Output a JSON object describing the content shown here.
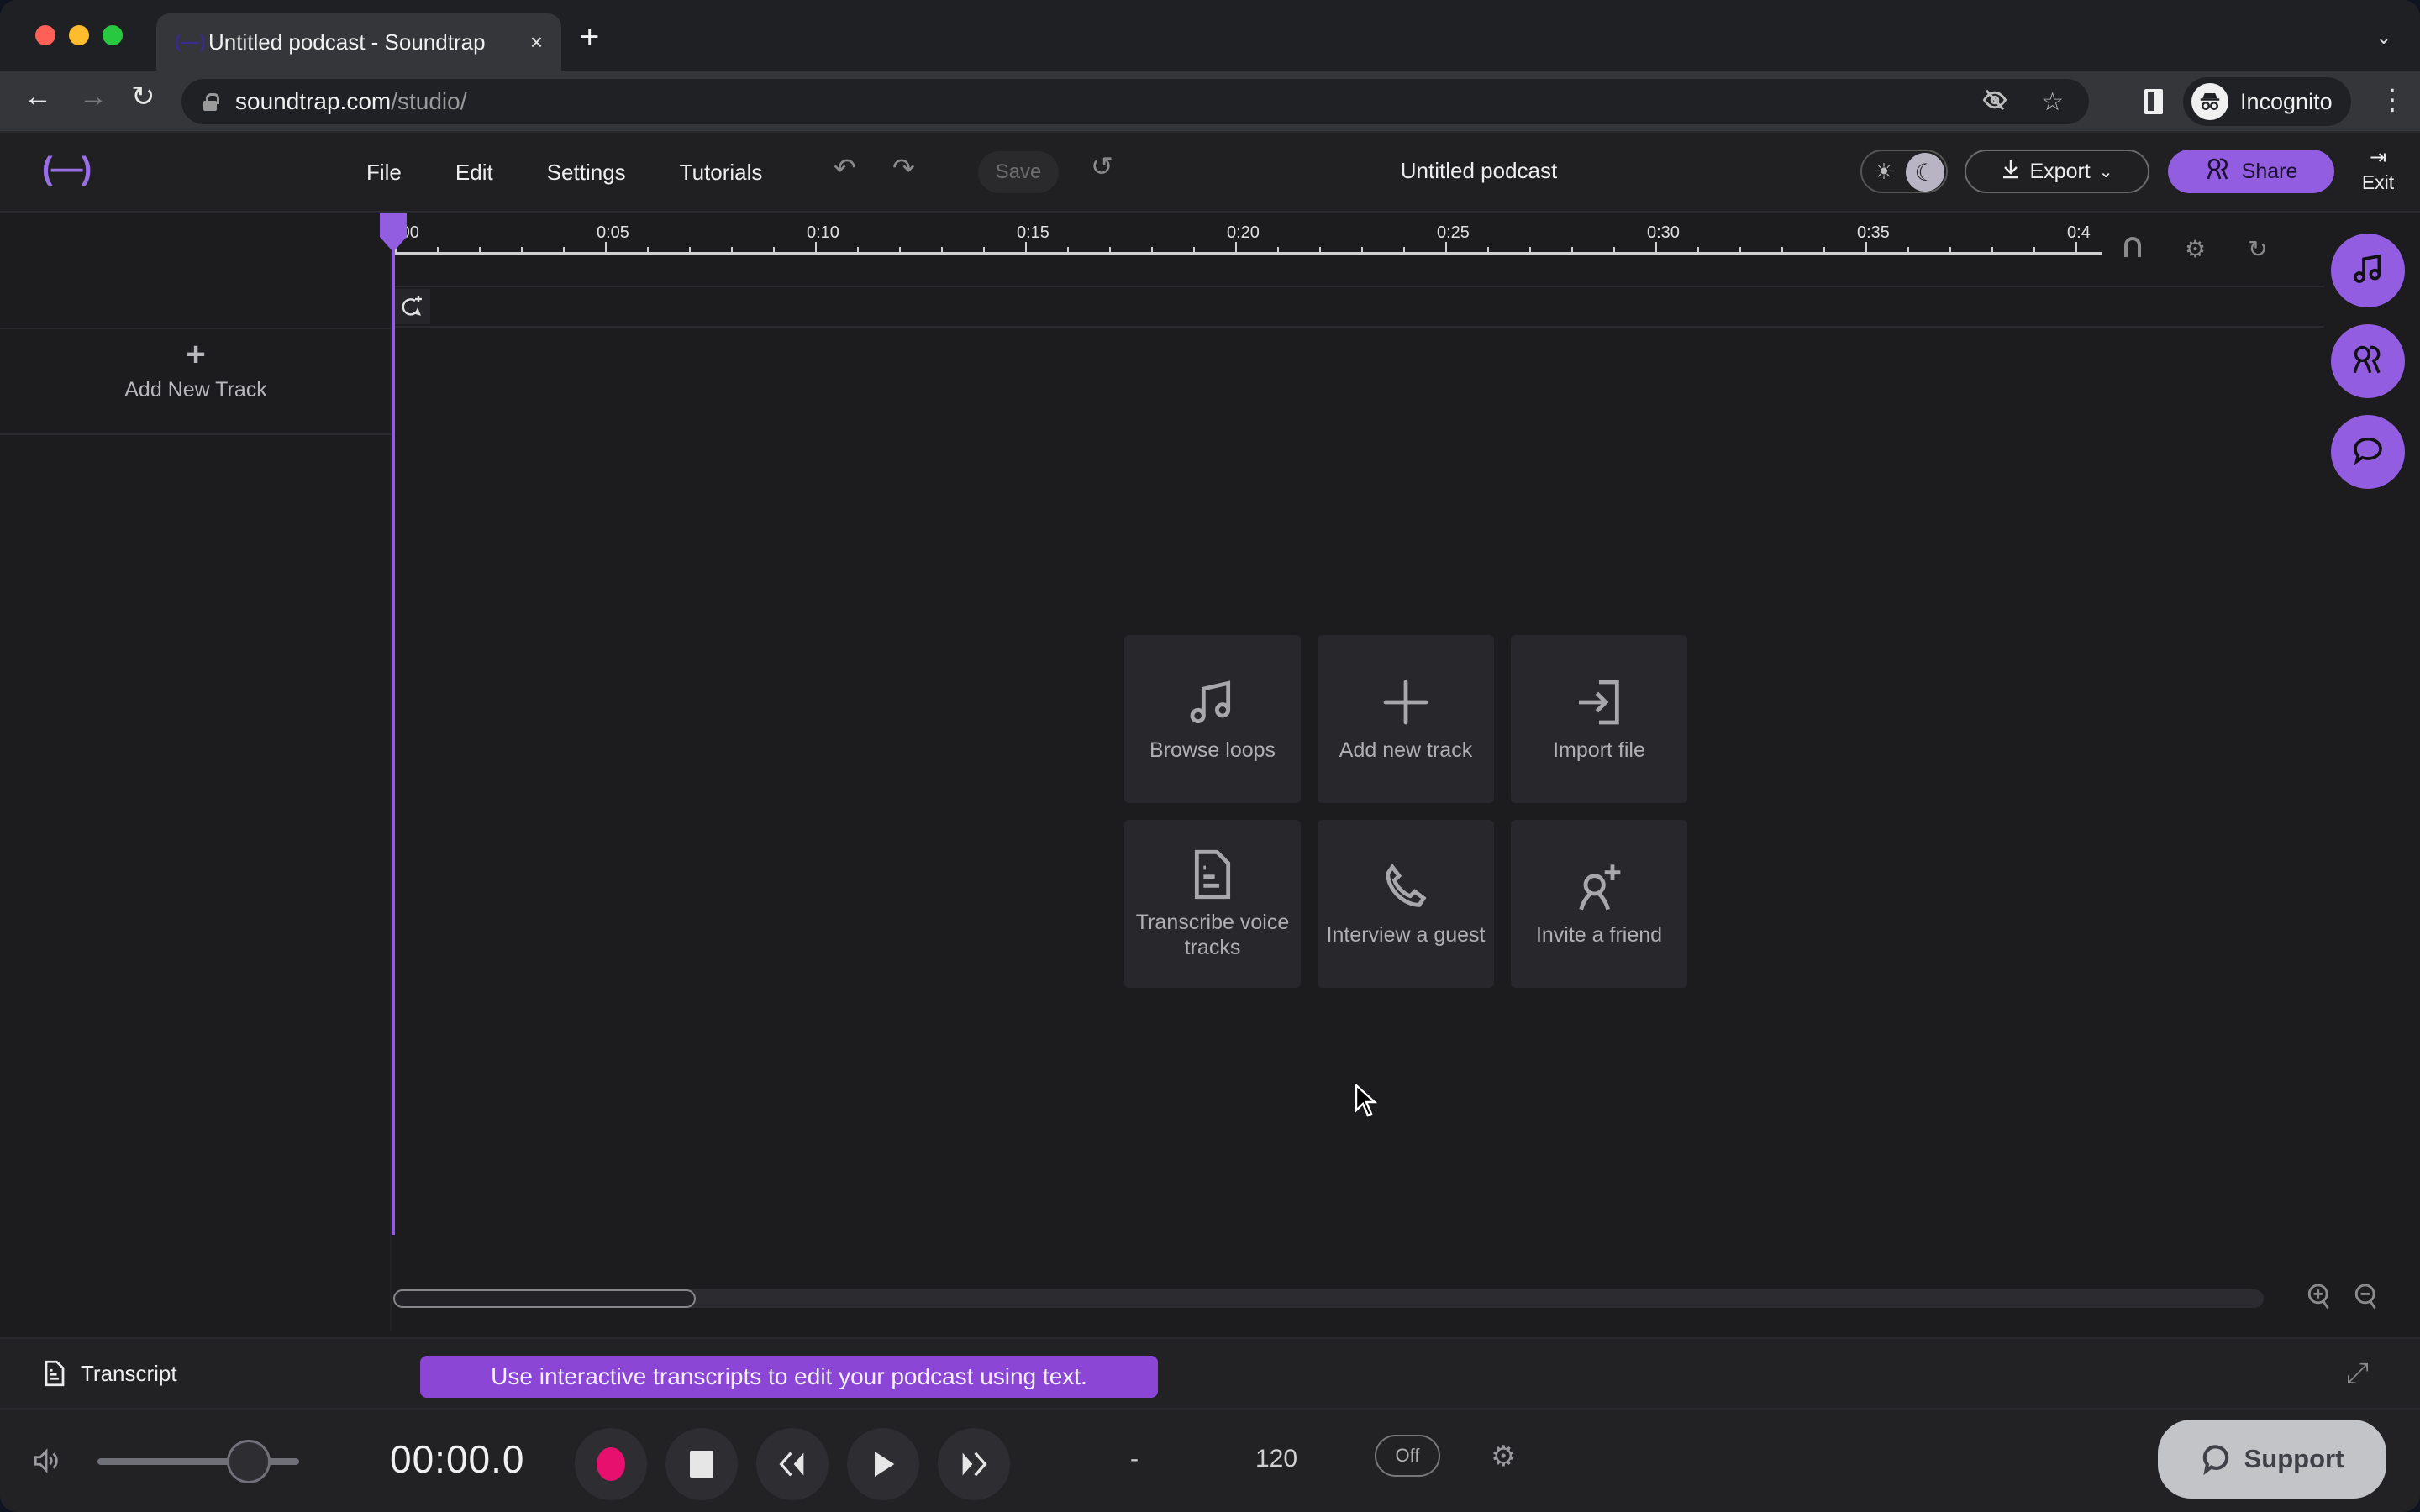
{
  "browser": {
    "tab_title": "Untitled podcast - Soundtrap",
    "tab_favicon": "(—)",
    "new_tab": "+",
    "close_tab": "×",
    "url_host": "soundtrap.com",
    "url_path": "/studio/",
    "profile_label": "Incognito",
    "icons": [
      "back-icon",
      "forward-icon",
      "reload-icon",
      "lock-icon",
      "eye-off-icon",
      "star-icon",
      "side-panel-icon",
      "incognito-icon",
      "kebab-menu-icon",
      "tab-list-icon"
    ]
  },
  "header": {
    "logo": "(—)",
    "menu": [
      "File",
      "Edit",
      "Settings",
      "Tutorials"
    ],
    "save_label": "Save",
    "project_title": "Untitled podcast",
    "export_label": "Export",
    "share_label": "Share",
    "exit_label": "Exit",
    "theme": "dark"
  },
  "timeline": {
    "ruler_labels": [
      "0:00",
      "0:05",
      "0:10",
      "0:15",
      "0:20",
      "0:25",
      "0:30",
      "0:35",
      "0:4"
    ],
    "playhead_time": "0:00",
    "tools": [
      "magnet-icon",
      "gear-icon",
      "loop-icon"
    ]
  },
  "tracks_panel": {
    "add_track_label": "Add New Track"
  },
  "side_buttons": [
    "music-note-icon",
    "collaborators-icon",
    "chat-icon"
  ],
  "actions": [
    {
      "label": "Browse loops",
      "icon": "music-note-icon"
    },
    {
      "label": "Add new track",
      "icon": "plus-icon"
    },
    {
      "label": "Import file",
      "icon": "import-icon"
    },
    {
      "label": "Transcribe voice tracks",
      "icon": "document-icon"
    },
    {
      "label": "Interview a guest",
      "icon": "phone-icon"
    },
    {
      "label": "Invite a friend",
      "icon": "add-user-icon"
    }
  ],
  "transcript": {
    "label": "Transcript",
    "banner": "Use interactive transcripts to edit your podcast using text."
  },
  "transport": {
    "time": "00:00.0",
    "volume_percent": 75,
    "key": "-",
    "tempo": "120",
    "metronome": "Off",
    "support_label": "Support"
  },
  "colors": {
    "accent": "#925de0",
    "record": "#e8106e",
    "banner": "#8c46d6"
  }
}
